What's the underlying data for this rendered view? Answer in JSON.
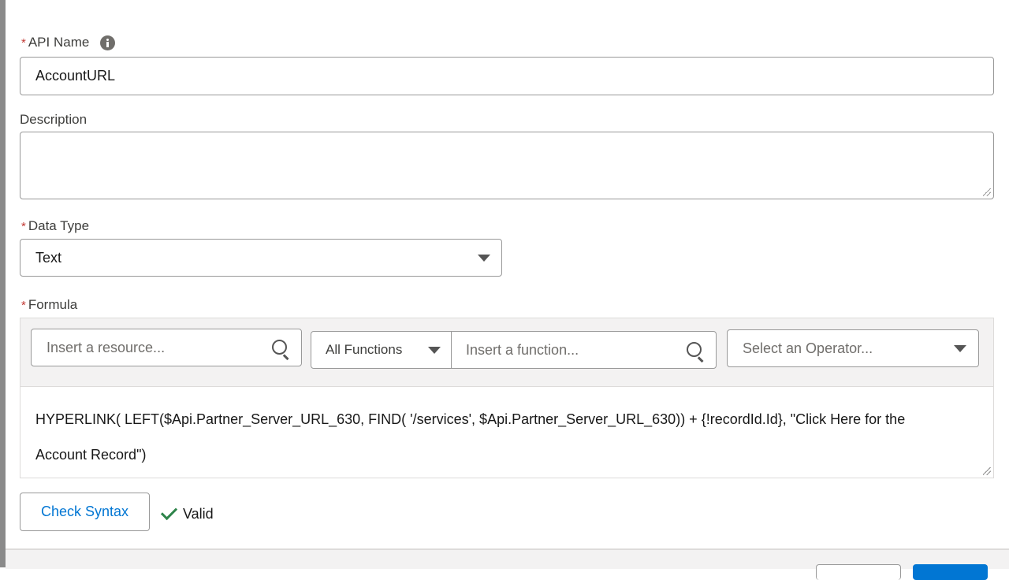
{
  "api_name": {
    "label": "API Name",
    "required_marker": "*",
    "value": "AccountURL"
  },
  "description": {
    "label": "Description",
    "value": ""
  },
  "data_type": {
    "label": "Data Type",
    "required_marker": "*",
    "selected": "Text"
  },
  "formula": {
    "label": "Formula",
    "required_marker": "*",
    "resource_placeholder": "Insert a resource...",
    "function_category": "All Functions",
    "function_placeholder": "Insert a function...",
    "operator_placeholder": "Select an Operator...",
    "line1": "HYPERLINK( LEFT($Api.Partner_Server_URL_630, FIND( '/services', $Api.Partner_Server_URL_630)) + {!recordId.Id}, \"Click Here for the",
    "line2": "Account Record\")"
  },
  "check_syntax": {
    "button_label": "Check Syntax",
    "status": "Valid"
  },
  "icons": {
    "info": "info-icon",
    "search": "search-icon",
    "dropdown": "chevron-down-icon",
    "valid": "checkmark-icon"
  },
  "colors": {
    "link_blue": "#0176d3",
    "required_red": "#c23934",
    "valid_green": "#2e844a"
  }
}
